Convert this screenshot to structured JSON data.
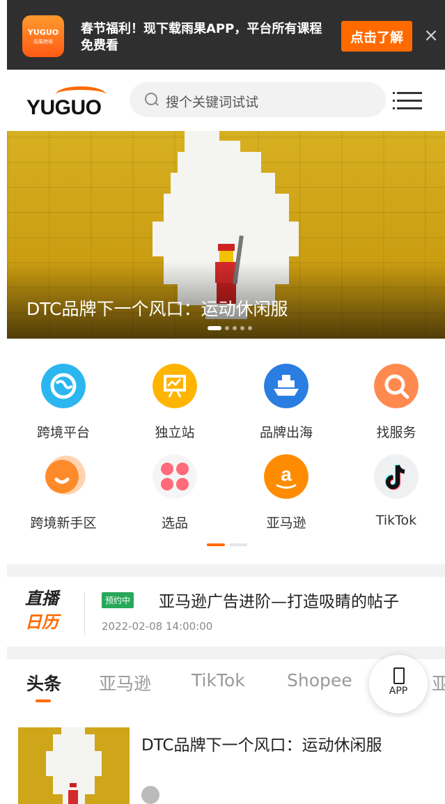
{
  "promo": {
    "app_logo_text": "YUGUO",
    "app_logo_sub": "雨果跨境",
    "message": "春节福利！现下载雨果APP，平台所有课程免费看",
    "cta": "点击了解",
    "close": "×"
  },
  "header": {
    "logo": "YUGUO",
    "search_placeholder": "搜个关键词试试"
  },
  "hero": {
    "title": "DTC品牌下一个风口：运动休闲服",
    "slides": 5,
    "active_slide": 1
  },
  "grid": {
    "items": [
      {
        "label": "跨境平台",
        "icon": "globe-icon",
        "color": "#2bb6f0"
      },
      {
        "label": "独立站",
        "icon": "presentation-icon",
        "color": "#ffb400"
      },
      {
        "label": "品牌出海",
        "icon": "ship-icon",
        "color": "#2a7de1"
      },
      {
        "label": "找服务",
        "icon": "search-icon",
        "color": "#ff8a50"
      },
      {
        "label": "跨境新手区",
        "icon": "newbie-icon",
        "color": "#ff8a2a"
      },
      {
        "label": "选品",
        "icon": "clover-icon",
        "color": "#ff6a7a"
      },
      {
        "label": "亚马逊",
        "icon": "amazon-icon",
        "color": "#ff8c00"
      },
      {
        "label": "TikTok",
        "icon": "tiktok-icon",
        "color": "#111111"
      }
    ]
  },
  "live": {
    "brand_line1": "直播",
    "brand_line2": "日历",
    "tag": "预约中",
    "title": "亚马逊广告进阶—打造吸睛的帖子",
    "time": "2022-02-08 14:00:00"
  },
  "tabs": [
    "头条",
    "亚马逊",
    "TikTok",
    "Shopee",
    "亚马"
  ],
  "app_button": "APP",
  "article": {
    "title": "DTC品牌下一个风口：运动休闲服"
  },
  "colors": {
    "accent": "#ff6a00",
    "banner_bg": "#2f2f2f",
    "tag_green": "#27a85a"
  }
}
